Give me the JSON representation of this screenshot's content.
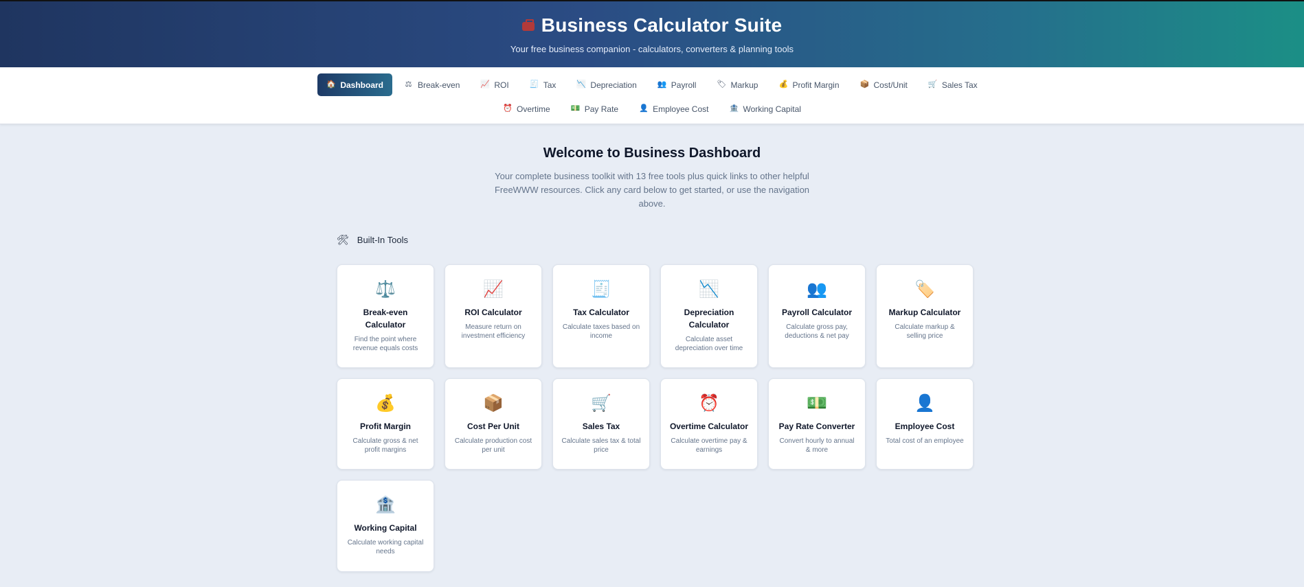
{
  "header": {
    "title": "Business Calculator Suite",
    "subtitle": "Your free business companion - calculators, converters & planning tools",
    "icon": "briefcase-icon"
  },
  "nav": {
    "row1": [
      {
        "label": "Dashboard",
        "icon": "🏠",
        "active": true
      },
      {
        "label": "Break-even",
        "icon": "⚖"
      },
      {
        "label": "ROI",
        "icon": "📈"
      },
      {
        "label": "Tax",
        "icon": "🧾"
      },
      {
        "label": "Depreciation",
        "icon": "📉"
      },
      {
        "label": "Payroll",
        "icon": "👥"
      },
      {
        "label": "Markup",
        "icon": "🏷"
      },
      {
        "label": "Profit Margin",
        "icon": "💰"
      },
      {
        "label": "Cost/Unit",
        "icon": "📦"
      },
      {
        "label": "Sales Tax",
        "icon": "🛒"
      }
    ],
    "row2": [
      {
        "label": "Overtime",
        "icon": "⏰"
      },
      {
        "label": "Pay Rate",
        "icon": "💵"
      },
      {
        "label": "Employee Cost",
        "icon": "👤"
      },
      {
        "label": "Working Capital",
        "icon": "🏦"
      }
    ]
  },
  "welcome": {
    "title": "Welcome to Business Dashboard",
    "text": "Your complete business toolkit with 13 free tools plus quick links to other helpful FreeWWW resources. Click any card below to get started, or use the navigation above."
  },
  "section": {
    "title": "Built-In Tools",
    "icon": "🛠"
  },
  "cards": [
    {
      "title": "Break-even Calculator",
      "desc": "Find the point where revenue equals costs",
      "icon": "⚖️"
    },
    {
      "title": "ROI Calculator",
      "desc": "Measure return on investment efficiency",
      "icon": "📈"
    },
    {
      "title": "Tax Calculator",
      "desc": "Calculate taxes based on income",
      "icon": "🧾"
    },
    {
      "title": "Depreciation Calculator",
      "desc": "Calculate asset depreciation over time",
      "icon": "📉"
    },
    {
      "title": "Payroll Calculator",
      "desc": "Calculate gross pay, deductions & net pay",
      "icon": "👥"
    },
    {
      "title": "Markup Calculator",
      "desc": "Calculate markup & selling price",
      "icon": "🏷️"
    },
    {
      "title": "Profit Margin",
      "desc": "Calculate gross & net profit margins",
      "icon": "💰"
    },
    {
      "title": "Cost Per Unit",
      "desc": "Calculate production cost per unit",
      "icon": "📦"
    },
    {
      "title": "Sales Tax",
      "desc": "Calculate sales tax & total price",
      "icon": "🛒"
    },
    {
      "title": "Overtime Calculator",
      "desc": "Calculate overtime pay & earnings",
      "icon": "⏰"
    },
    {
      "title": "Pay Rate Converter",
      "desc": "Convert hourly to annual & more",
      "icon": "💵"
    },
    {
      "title": "Employee Cost",
      "desc": "Total cost of an employee",
      "icon": "👤"
    },
    {
      "title": "Working Capital",
      "desc": "Calculate working capital needs",
      "icon": "🏦"
    }
  ]
}
